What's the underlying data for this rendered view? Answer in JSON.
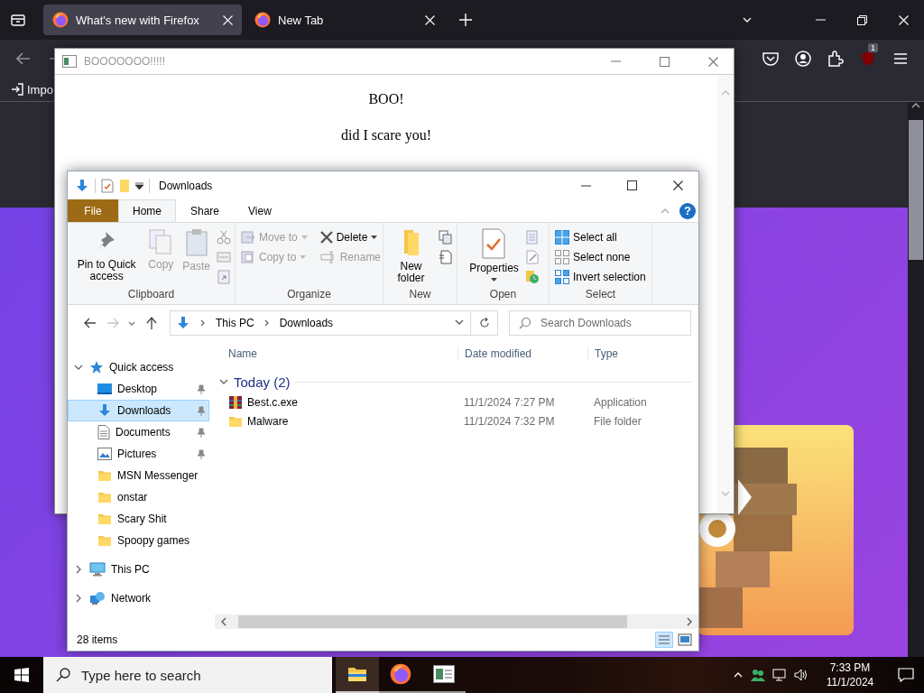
{
  "browser": {
    "tabs": [
      {
        "title": "What's new with Firefox",
        "selected": true
      },
      {
        "title": "New Tab",
        "selected": false
      }
    ],
    "extension_badge": "1",
    "bookmarks": [
      "Impo"
    ]
  },
  "popup_window": {
    "title": "BOOOOOOO!!!!!",
    "heading": "BOO!",
    "text": "did I scare you!"
  },
  "explorer": {
    "title": "Downloads",
    "ribbon_tabs": [
      {
        "label": "File",
        "kind": "file",
        "selected": false
      },
      {
        "label": "Home",
        "kind": "tab",
        "selected": true
      },
      {
        "label": "Share",
        "kind": "tab",
        "selected": false
      },
      {
        "label": "View",
        "kind": "tab",
        "selected": false
      }
    ],
    "help_glyph": "?",
    "ribbon_groups": [
      {
        "label": "Clipboard",
        "buttons": [
          {
            "label": "Pin to Quick access",
            "kind": "large",
            "disabled": false
          },
          {
            "label": "Copy",
            "kind": "large",
            "disabled": true
          },
          {
            "label": "Paste",
            "kind": "large",
            "disabled": true
          }
        ]
      },
      {
        "label": "Organize",
        "buttons": [
          {
            "label": "Move to",
            "kind": "small",
            "disabled": true
          },
          {
            "label": "Copy to",
            "kind": "small",
            "disabled": true
          },
          {
            "label": "Delete",
            "kind": "small",
            "disabled": false
          },
          {
            "label": "Rename",
            "kind": "small",
            "disabled": true
          }
        ]
      },
      {
        "label": "New",
        "buttons": [
          {
            "label": "New folder",
            "kind": "large",
            "disabled": false
          }
        ]
      },
      {
        "label": "Open",
        "buttons": [
          {
            "label": "Properties",
            "kind": "large",
            "disabled": false
          }
        ]
      },
      {
        "label": "Select",
        "buttons": [
          {
            "label": "Select all",
            "kind": "small",
            "disabled": false
          },
          {
            "label": "Select none",
            "kind": "small",
            "disabled": false
          },
          {
            "label": "Invert selection",
            "kind": "small",
            "disabled": false
          }
        ]
      }
    ],
    "address": [
      "This PC",
      "Downloads"
    ],
    "search_placeholder": "Search Downloads",
    "columns": [
      "Name",
      "Date modified",
      "Type"
    ],
    "group": "Today (2)",
    "files": [
      {
        "name": "Best.c.exe",
        "date": "11/1/2024 7:27 PM",
        "type": "Application",
        "kind": "exe"
      },
      {
        "name": "Malware",
        "date": "11/1/2024 7:32 PM",
        "type": "File folder",
        "kind": "folder"
      }
    ],
    "nav": [
      {
        "label": "Quick access",
        "kind": "star",
        "expanded": true,
        "children": [
          {
            "label": "Desktop",
            "kind": "desktop",
            "pinned": true,
            "selected": false
          },
          {
            "label": "Downloads",
            "kind": "downloads",
            "pinned": true,
            "selected": true
          },
          {
            "label": "Documents",
            "kind": "documents",
            "pinned": true,
            "selected": false
          },
          {
            "label": "Pictures",
            "kind": "pictures",
            "pinned": true,
            "selected": false
          },
          {
            "label": "MSN Messenger",
            "kind": "folder",
            "pinned": false,
            "selected": false
          },
          {
            "label": "onstar",
            "kind": "folder",
            "pinned": false,
            "selected": false
          },
          {
            "label": "Scary Shit",
            "kind": "folder",
            "pinned": false,
            "selected": false
          },
          {
            "label": "Spoopy games",
            "kind": "folder",
            "pinned": false,
            "selected": false
          }
        ]
      },
      {
        "label": "This PC",
        "kind": "pc",
        "expanded": false
      },
      {
        "label": "Network",
        "kind": "network",
        "expanded": false
      }
    ],
    "status": "28 items"
  },
  "taskbar": {
    "search_placeholder": "Type here to search",
    "apps": [
      {
        "kind": "explorer",
        "selected": true
      },
      {
        "kind": "firefox",
        "selected": false
      },
      {
        "kind": "window",
        "selected": false
      }
    ],
    "time": "7:33 PM",
    "date": "11/1/2024"
  }
}
